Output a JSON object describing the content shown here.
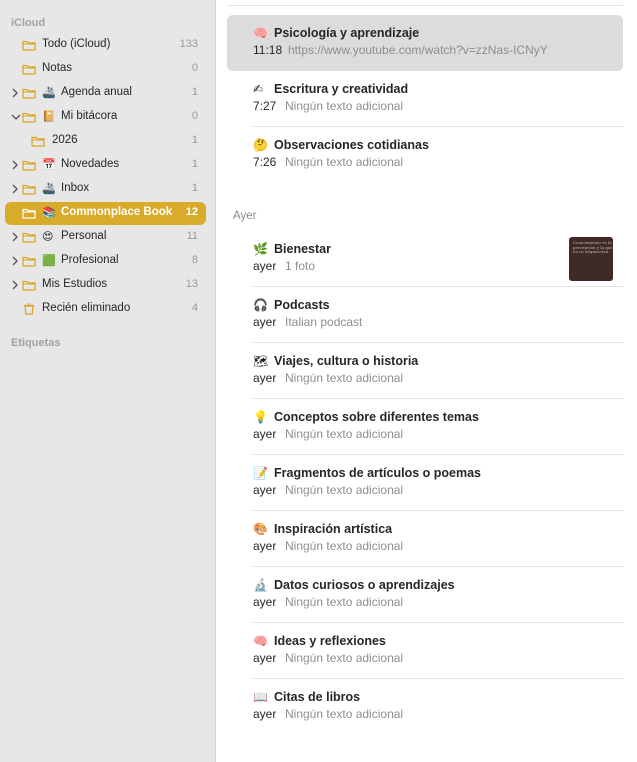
{
  "sidebar": {
    "section_icloud": "iCloud",
    "section_tags": "Etiquetas",
    "folders": [
      {
        "label": "Todo (iCloud)",
        "count": "133"
      },
      {
        "label": "Notas",
        "count": "0"
      },
      {
        "label": "Agenda anual",
        "count": "1",
        "emoji": "🚢"
      },
      {
        "label": "Mi bitácora",
        "count": "0",
        "emoji": "📔"
      },
      {
        "label": "2026",
        "count": "1"
      },
      {
        "label": "Novedades",
        "count": "1",
        "emoji": "📅"
      },
      {
        "label": "Inbox",
        "count": "1",
        "emoji": "🚢"
      },
      {
        "label": "Commonplace Book",
        "count": "12",
        "emoji": "📚"
      },
      {
        "label": "Personal",
        "count": "11",
        "emoji": "😍"
      },
      {
        "label": "Profesional",
        "count": "8",
        "emoji": "🟩"
      },
      {
        "label": "Mis Estudios",
        "count": "13"
      },
      {
        "label": "Recién eliminado",
        "count": "4"
      }
    ]
  },
  "notes": {
    "day_header_yesterday": "Ayer",
    "today": [
      {
        "emoji": "🧠",
        "title": "Psicología y aprendizaje",
        "time": "11:18",
        "preview": "https://www.youtube.com/watch?v=zzNas-ICNyY"
      },
      {
        "emoji": "✍",
        "title": "Escritura y creatividad",
        "time": "7:27",
        "preview": "Ningún texto adicional"
      },
      {
        "emoji": "🤔",
        "title": "Observaciones cotidianas",
        "time": "7:26",
        "preview": "Ningún texto adicional"
      }
    ],
    "yesterday": [
      {
        "emoji": "🌿",
        "title": "Bienestar",
        "time": "ayer",
        "preview": "1 foto"
      },
      {
        "emoji": "🎧",
        "title": "Podcasts",
        "time": "ayer",
        "preview": "Italian podcast"
      },
      {
        "emoji": "🗺",
        "title": "Viajes, cultura o historia",
        "time": "ayer",
        "preview": "Ningún texto adicional"
      },
      {
        "emoji": "💡",
        "title": "Conceptos sobre diferentes temas",
        "time": "ayer",
        "preview": "Ningún texto adicional"
      },
      {
        "emoji": "📝",
        "title": "Fragmentos de artículos o poemas",
        "time": "ayer",
        "preview": "Ningún texto adicional"
      },
      {
        "emoji": "🎨",
        "title": "Inspiración artística",
        "time": "ayer",
        "preview": "Ningún texto adicional"
      },
      {
        "emoji": "🔬",
        "title": "Datos curiosos o aprendizajes",
        "time": "ayer",
        "preview": "Ningún texto adicional"
      },
      {
        "emoji": "🧠",
        "title": "Ideas y reflexiones",
        "time": "ayer",
        "preview": "Ningún texto adicional"
      },
      {
        "emoji": "📖",
        "title": "Citas de libros",
        "time": "ayer",
        "preview": "Ningún texto adicional"
      }
    ],
    "thumbnail_text": "Conocimiento es la percepción y la que no es adquisición"
  },
  "colors": {
    "accent": "#d9ab2b",
    "sidebar_bg": "#e7e7e7",
    "selected_note_bg": "#dcdcdc"
  }
}
